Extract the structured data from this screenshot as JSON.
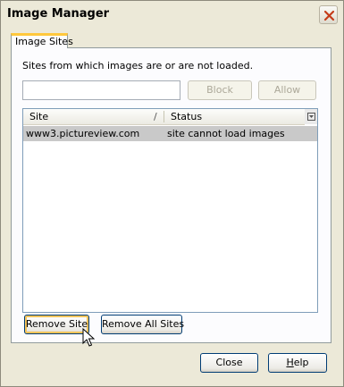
{
  "window": {
    "title": "Image Manager"
  },
  "tabs": [
    {
      "label": "Image Sites"
    }
  ],
  "description": "Sites from which images are or are not loaded.",
  "site_input": {
    "value": "",
    "placeholder": ""
  },
  "buttons": {
    "block": "Block",
    "allow": "Allow",
    "remove_site": "Remove Site",
    "remove_all": "Remove All Sites",
    "close": "Close",
    "help_prefix": "",
    "help_underlined": "H",
    "help_rest": "elp"
  },
  "table": {
    "columns": [
      "Site",
      "Status"
    ],
    "sort_indicator": "/",
    "rows": [
      {
        "site": "www3.pictureview.com",
        "status": "site cannot load images"
      }
    ]
  },
  "icons": {
    "close": "close-icon",
    "cursor": "mouse-pointer-icon"
  },
  "colors": {
    "tab_accent": "#ffc83c",
    "selected_row": "#c9c9c9",
    "close_x": "#c43c1a"
  }
}
